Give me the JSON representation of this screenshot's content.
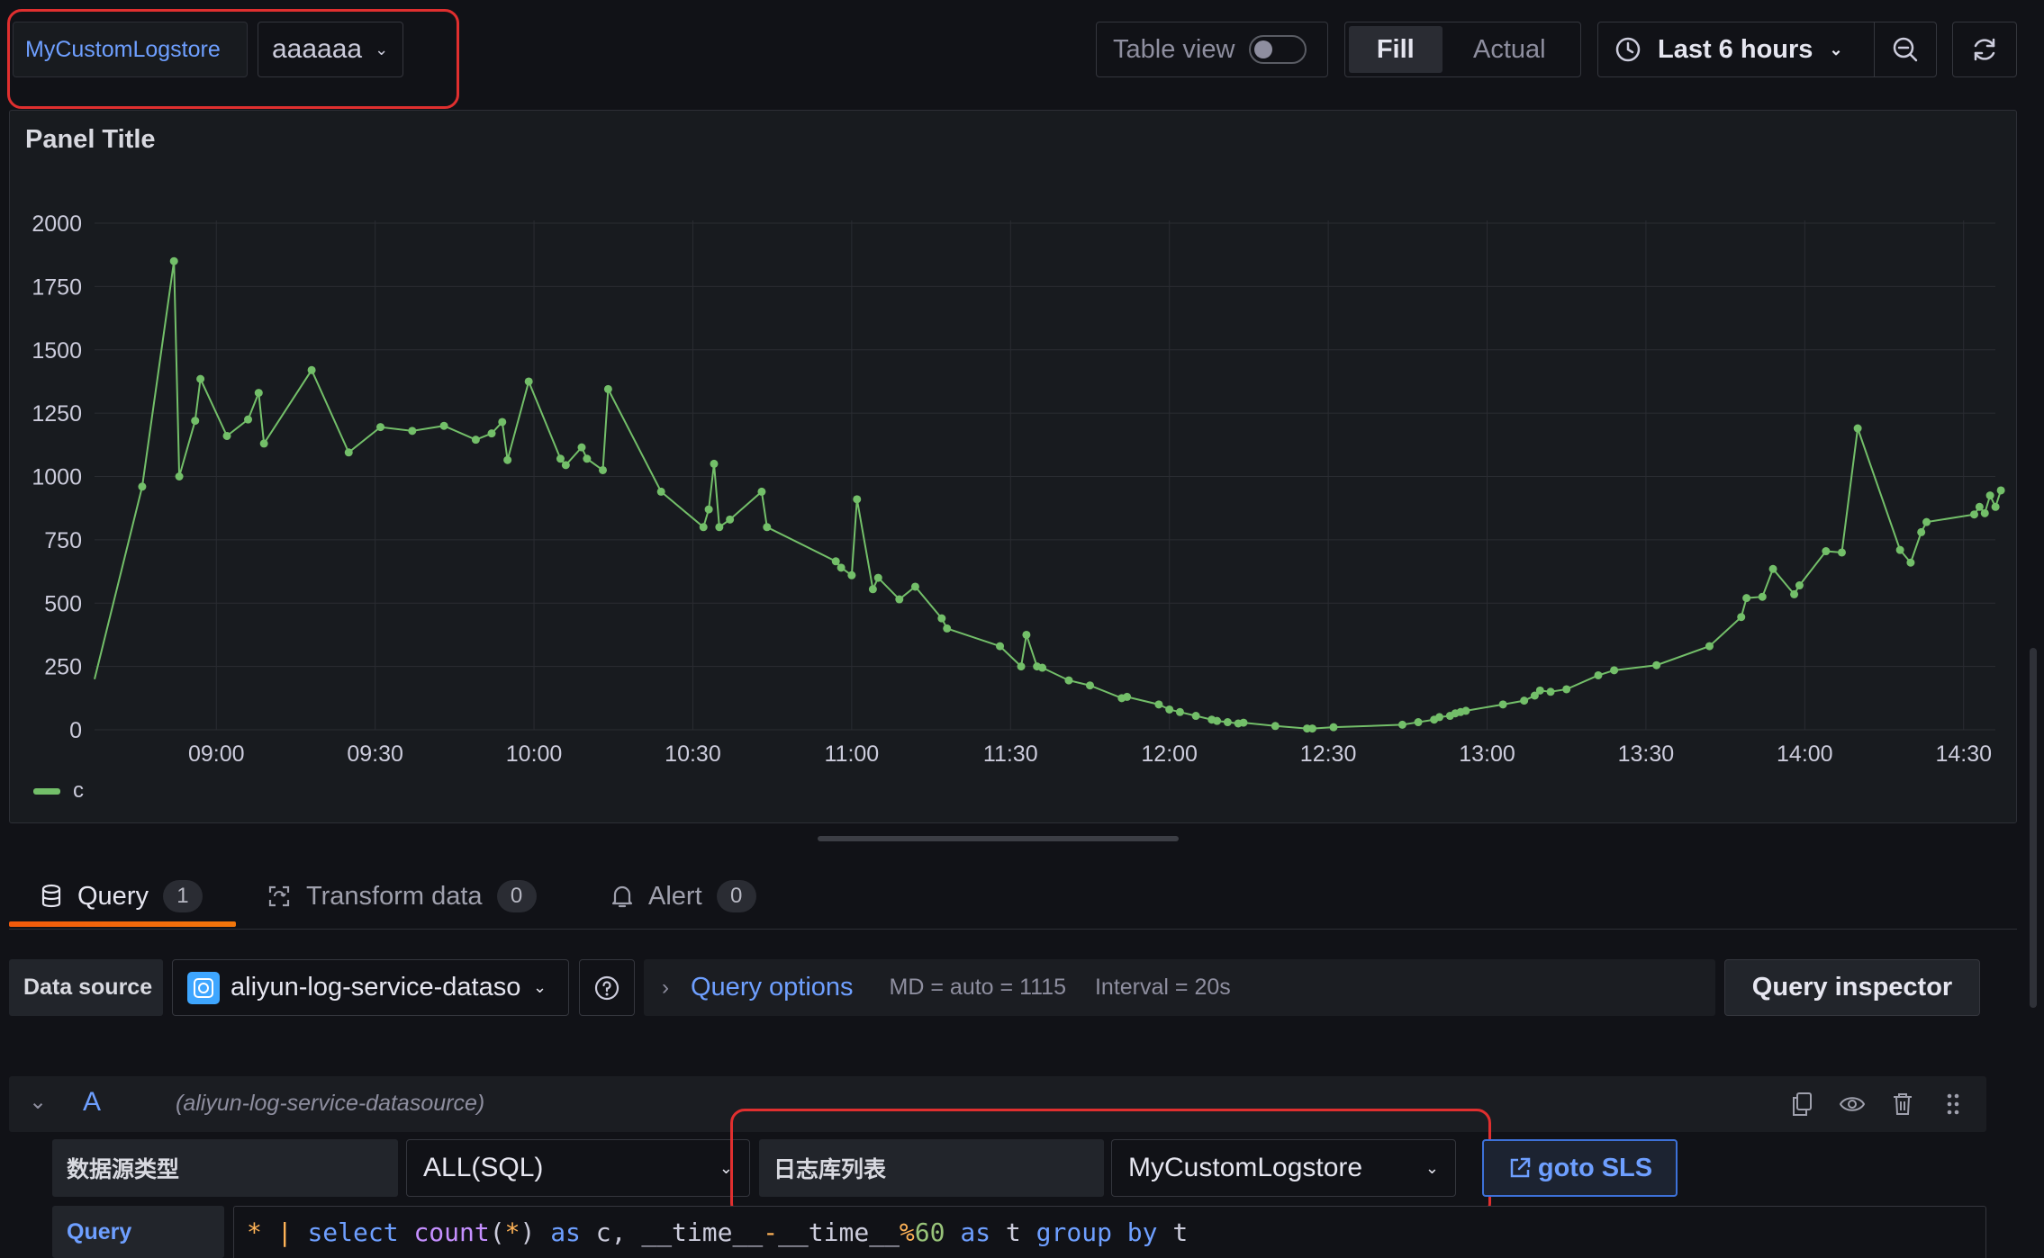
{
  "toolbar": {
    "variable_label": "MyCustomLogstore",
    "variable_value": "aaaaaa",
    "table_view_label": "Table view",
    "table_view_on": false,
    "fill_label": "Fill",
    "actual_label": "Actual",
    "time_range": "Last 6 hours"
  },
  "panel": {
    "title": "Panel Title",
    "legend_label": "c"
  },
  "chart_data": {
    "type": "line",
    "title": "Panel Title",
    "series_color": "#73bf69",
    "ylim": [
      0,
      2000
    ],
    "y_ticks": [
      "0",
      "250",
      "500",
      "750",
      "1000",
      "1250",
      "1500",
      "1750",
      "2000"
    ],
    "x_ticks": [
      "09:00",
      "09:30",
      "10:00",
      "10:30",
      "11:00",
      "11:30",
      "12:00",
      "12:30",
      "13:00",
      "13:30",
      "14:00",
      "14:30"
    ],
    "grid": true,
    "legend": "bottom-left",
    "series": [
      {
        "name": "c",
        "x": [
          "08:37",
          "08:46",
          "08:52",
          "08:53",
          "08:56",
          "08:57",
          "09:02",
          "09:06",
          "09:08",
          "09:09",
          "09:18",
          "09:25",
          "09:31",
          "09:37",
          "09:43",
          "09:49",
          "09:52",
          "09:54",
          "09:55",
          "09:59",
          "10:05",
          "10:06",
          "10:09",
          "10:10",
          "10:13",
          "10:14",
          "10:24",
          "10:32",
          "10:33",
          "10:34",
          "10:35",
          "10:37",
          "10:43",
          "10:44",
          "10:57",
          "10:58",
          "11:00",
          "11:01",
          "11:04",
          "11:05",
          "11:09",
          "11:12",
          "11:17",
          "11:18",
          "11:28",
          "11:32",
          "11:33",
          "11:35",
          "11:36",
          "11:41",
          "11:45",
          "11:51",
          "11:52",
          "11:58",
          "12:00",
          "12:02",
          "12:05",
          "12:08",
          "12:09",
          "12:11",
          "12:13",
          "12:14",
          "12:20",
          "12:26",
          "12:27",
          "12:31",
          "12:44",
          "12:47",
          "12:50",
          "12:51",
          "12:53",
          "12:54",
          "12:55",
          "12:56",
          "13:03",
          "13:07",
          "13:09",
          "13:10",
          "13:12",
          "13:15",
          "13:21",
          "13:24",
          "13:32",
          "13:42",
          "13:48",
          "13:49",
          "13:52",
          "13:54",
          "13:58",
          "13:59",
          "14:04",
          "14:07",
          "14:10",
          "14:18",
          "14:20",
          "14:22",
          "14:23",
          "14:32",
          "14:33",
          "14:34",
          "14:35"
        ],
        "values": [
          200,
          960,
          1850,
          1000,
          1220,
          1385,
          1160,
          1225,
          1330,
          1130,
          1420,
          1095,
          1195,
          1180,
          1200,
          1145,
          1170,
          1215,
          1065,
          1375,
          1070,
          1045,
          1115,
          1070,
          1025,
          1345,
          940,
          800,
          870,
          1050,
          800,
          830,
          940,
          800,
          665,
          640,
          610,
          910,
          555,
          600,
          515,
          565,
          440,
          400,
          330,
          250,
          375,
          250,
          245,
          195,
          175,
          125,
          130,
          100,
          80,
          70,
          55,
          40,
          35,
          30,
          25,
          28,
          15,
          5,
          5,
          10,
          20,
          30,
          40,
          50,
          55,
          65,
          70,
          75,
          100,
          115,
          135,
          155,
          150,
          160,
          215,
          235,
          255,
          330,
          445,
          520,
          525,
          635,
          535,
          570,
          705,
          700,
          1190,
          710,
          660,
          780,
          820,
          850,
          880,
          855,
          925
        ],
        "note_tail": [
          880,
          945
        ]
      }
    ]
  },
  "tabs": [
    {
      "label": "Query",
      "count": "1"
    },
    {
      "label": "Transform data",
      "count": "0"
    },
    {
      "label": "Alert",
      "count": "0"
    }
  ],
  "datasource": {
    "label": "Data source",
    "value": "aliyun-log-service-datasource",
    "query_options_label": "Query options",
    "md_info": "MD = auto = 1115",
    "interval_info": "Interval = 20s",
    "inspector_label": "Query inspector"
  },
  "query_a": {
    "letter": "A",
    "datasource_hint": "(aliyun-log-service-datasource)",
    "type_label": "数据源类型",
    "type_value": "ALL(SQL)",
    "logstore_label": "日志库列表",
    "logstore_value": "MyCustomLogstore",
    "goto_label": "goto SLS",
    "query_label": "Query",
    "query_tokens": [
      {
        "t": "*",
        "c": "tk-op"
      },
      {
        "t": " | ",
        "c": "tk-op"
      },
      {
        "t": "select",
        "c": "tk-kw"
      },
      {
        "t": " ",
        "c": "tk-id"
      },
      {
        "t": "count",
        "c": "tk-fn"
      },
      {
        "t": "(",
        "c": "tk-id"
      },
      {
        "t": "*",
        "c": "tk-op"
      },
      {
        "t": ") ",
        "c": "tk-id"
      },
      {
        "t": "as",
        "c": "tk-kw"
      },
      {
        "t": " c, __time__",
        "c": "tk-id"
      },
      {
        "t": "-",
        "c": "tk-op"
      },
      {
        "t": "__time__",
        "c": "tk-id"
      },
      {
        "t": "%",
        "c": "tk-op"
      },
      {
        "t": "60",
        "c": "tk-num"
      },
      {
        "t": " ",
        "c": "tk-id"
      },
      {
        "t": "as",
        "c": "tk-kw"
      },
      {
        "t": " t ",
        "c": "tk-id"
      },
      {
        "t": "group by",
        "c": "tk-kw"
      },
      {
        "t": " t",
        "c": "tk-id"
      }
    ]
  }
}
